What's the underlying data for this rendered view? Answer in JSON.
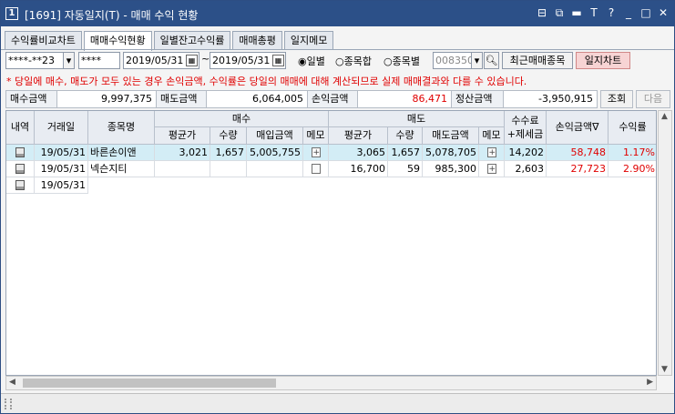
{
  "window": {
    "app_number": "1",
    "title": "[1691] 자동일지(T) - 매매 수익 현황",
    "buttons": [
      "⊟",
      "⧉",
      "▬",
      "T",
      "?",
      "_",
      "□",
      "✕"
    ]
  },
  "tabs": [
    {
      "label": "수익률비교차트",
      "active": false
    },
    {
      "label": "매매수익현황",
      "active": true
    },
    {
      "label": "일별잔고수익률",
      "active": false
    },
    {
      "label": "매매총평",
      "active": false
    },
    {
      "label": "일지메모",
      "active": false
    }
  ],
  "controls": {
    "account": "****-**23",
    "password": "****",
    "date_from": "2019/05/31",
    "date_sep": "~",
    "date_to": "2019/05/31",
    "radios": [
      {
        "label": "일별",
        "checked": true
      },
      {
        "label": "종목합",
        "checked": false
      },
      {
        "label": "종목별",
        "checked": false
      }
    ],
    "stock_code": "008350",
    "recent_button": "최근매매종목",
    "chart_button": "일지차트"
  },
  "notice": "* 당일에 매수, 매도가 모두 있는 경우 손익금액, 수익률은 당일의 매매에 대해 계산되므로 실제 매매결과와 다를 수 있습니다.",
  "summary": {
    "buy_label": "매수금액",
    "buy_value": "9,997,375",
    "sell_label": "매도금액",
    "sell_value": "6,064,005",
    "pl_label": "손익금액",
    "pl_value": "86,471",
    "settle_label": "정산금액",
    "settle_value": "-3,950,915",
    "query_button": "조회",
    "next_button": "다음"
  },
  "grid": {
    "headers": {
      "type": "내역",
      "date": "거래일",
      "name": "종목명",
      "buy_group": "매수",
      "sell_group": "매도",
      "fee": "수수료\n+제세금",
      "pl": "손익금액",
      "pl_sort": "∇",
      "rate": "수익률",
      "buy_cols": [
        "평균가",
        "수량",
        "매입금액",
        "메모"
      ],
      "sell_cols": [
        "평균가",
        "수량",
        "매도금액",
        "메모"
      ]
    },
    "rows": [
      {
        "date": "19/05/31",
        "name": "바른손이앤",
        "buy_avg": "3,021",
        "buy_qty": "1,657",
        "buy_amt": "5,005,755",
        "sell_avg": "3,065",
        "sell_qty": "1,657",
        "sell_amt": "5,078,705",
        "fee": "14,202",
        "pl": "58,748",
        "rate": "1.17%",
        "selected": true
      },
      {
        "date": "19/05/31",
        "name": "넥슨지티",
        "buy_avg": "",
        "buy_qty": "",
        "buy_amt": "",
        "sell_avg": "16,700",
        "sell_qty": "59",
        "sell_amt": "985,300",
        "fee": "2,603",
        "pl": "27,723",
        "rate": "2.90%",
        "selected": false
      },
      {
        "date": "19/05/31",
        "name": "",
        "buy_avg": "",
        "buy_qty": "",
        "buy_amt": "",
        "sell_avg": "",
        "sell_qty": "",
        "sell_amt": "",
        "fee": "",
        "pl": "",
        "rate": "",
        "selected": false
      }
    ]
  },
  "colors": {
    "titlebar": "#2c5088",
    "selected_row": "#d3edf6",
    "loss_profit_text": "#e00000",
    "chart_button_bg": "#f7d4d4"
  }
}
